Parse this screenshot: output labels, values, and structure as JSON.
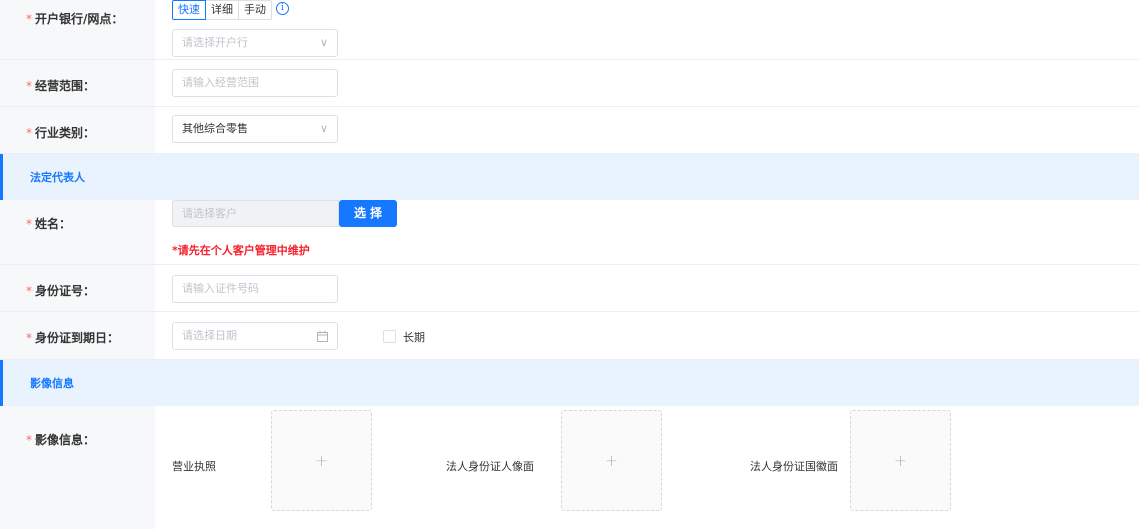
{
  "bank": {
    "label": "开户银行/网点：",
    "required_mark": "*",
    "modes": [
      "快速",
      "详细",
      "手动"
    ],
    "active_mode": "快速",
    "info_icon": "info-circle-icon",
    "placeholder": "请选择开户行",
    "chevron": "∨"
  },
  "scope": {
    "label": "经营范围：",
    "required_mark": "*",
    "placeholder": "请输入经营范围"
  },
  "industry": {
    "label": "行业类别：",
    "required_mark": "*",
    "value": "其他综合零售",
    "chevron": "∨"
  },
  "section_legal": {
    "title": "法定代表人"
  },
  "name": {
    "label": "姓名：",
    "required_mark": "*",
    "placeholder": "请选择客户",
    "select_button": "选择",
    "warning": "*请先在个人客户管理中维护"
  },
  "id_number": {
    "label": "身份证号：",
    "required_mark": "*",
    "placeholder": "请输入证件号码"
  },
  "id_expiry": {
    "label": "身份证到期日：",
    "required_mark": "*",
    "placeholder": "请选择日期",
    "calendar_icon": "calendar-icon",
    "long_term_label": "长期"
  },
  "section_image": {
    "title": "影像信息"
  },
  "images": {
    "label": "影像信息：",
    "required_mark": "*",
    "items": [
      {
        "label": "营业执照",
        "plus": "+"
      },
      {
        "label": "法人身份证人像面",
        "plus": "+"
      },
      {
        "label": "法人身份证国徽面",
        "plus": "+"
      }
    ]
  },
  "colors": {
    "primary": "#1677ff",
    "required": "#f56c6c",
    "warning": "#f5222d",
    "section_bg": "#e8f3fd"
  }
}
